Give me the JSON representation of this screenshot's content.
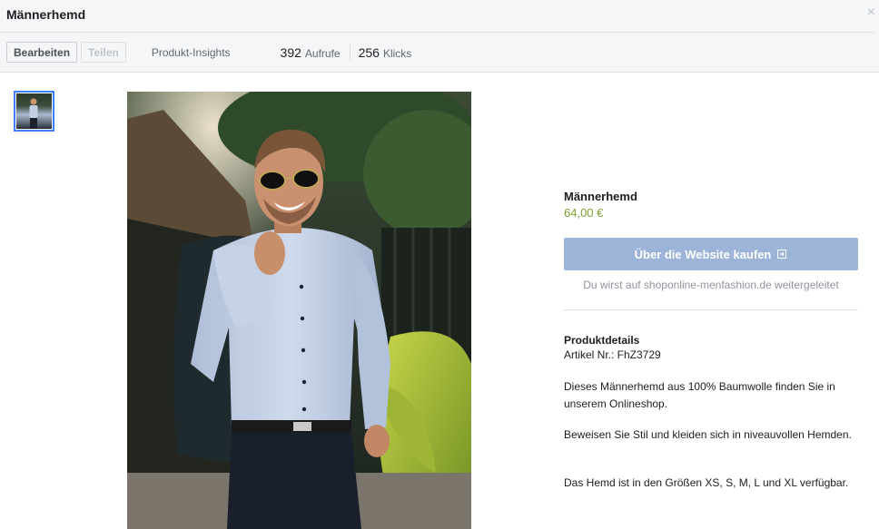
{
  "header": {
    "title": "Männerhemd",
    "close_glyph": "×",
    "edit_label": "Bearbeiten",
    "share_label": "Teilen",
    "insights_label": "Produkt-Insights",
    "views_count": "392",
    "views_label": "Aufrufe",
    "clicks_count": "256",
    "clicks_label": "Klicks"
  },
  "product": {
    "name": "Männerhemd",
    "price": "64,00 €",
    "buy_label": "Über die Website kaufen",
    "redirect_note": "Du wirst auf shoponline-menfashion.de weitergeleitet",
    "details_title": "Produktdetails",
    "article_number": "Artikel Nr.: FhZ3729",
    "paragraphs": [
      "Dieses Männerhemd aus 100% Baumwolle finden Sie in unserem Onlineshop.",
      "Beweisen Sie Stil und kleiden sich in niveauvollen Hemden.",
      "Das Hemd ist in den Größen XS, S, M, L und XL verfügbar."
    ]
  },
  "colors": {
    "accent": "#4080ff",
    "buy_button": "#9cb4d8",
    "price": "#7ea030",
    "header_bg": "#f5f6f7"
  },
  "icons": {
    "close": "close-icon",
    "external": "external-link-icon"
  }
}
